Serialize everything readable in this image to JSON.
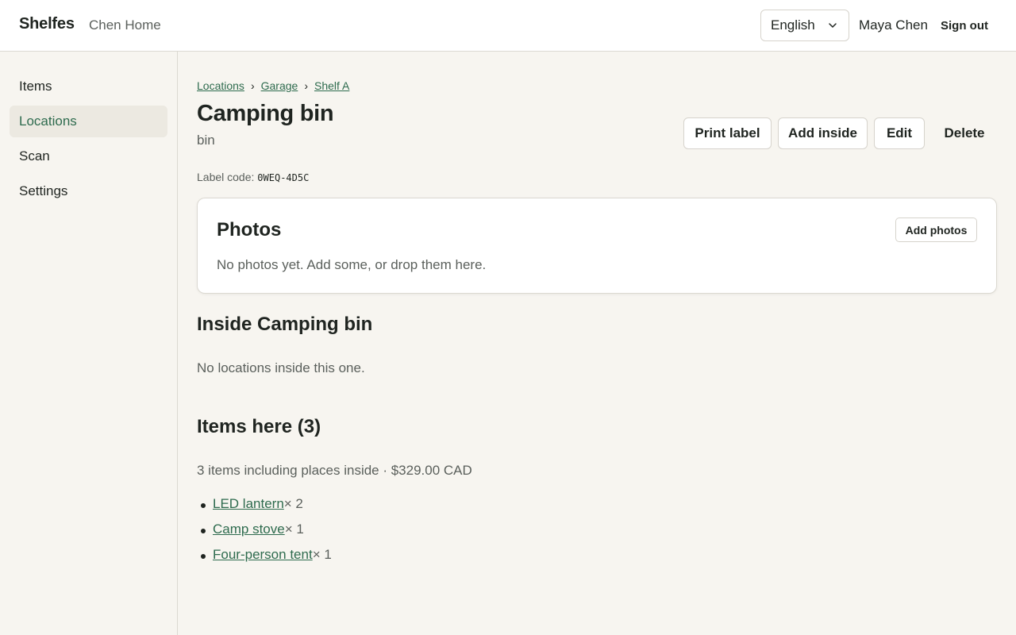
{
  "header": {
    "brand": "Shelfes",
    "household": "Chen Home",
    "language": "English",
    "user_name": "Maya Chen",
    "sign_out": "Sign out"
  },
  "sidebar": {
    "items": [
      {
        "label": "Items",
        "active": false
      },
      {
        "label": "Locations",
        "active": true
      },
      {
        "label": "Scan",
        "active": false
      },
      {
        "label": "Settings",
        "active": false
      }
    ]
  },
  "breadcrumb": {
    "items": [
      "Locations",
      "Garage",
      "Shelf A"
    ],
    "separator": "›"
  },
  "location": {
    "title": "Camping bin",
    "kind": "bin",
    "label_code_prefix": "Label code:",
    "label_code": "0WEQ-4D5C"
  },
  "actions": {
    "print_label": "Print label",
    "add_inside": "Add inside",
    "edit": "Edit",
    "delete": "Delete"
  },
  "photos": {
    "title": "Photos",
    "add_button": "Add photos",
    "empty_text": "No photos yet. Add some, or drop them here."
  },
  "inside": {
    "title": "Inside Camping bin",
    "empty_text": "No locations inside this one."
  },
  "items_here": {
    "title": "Items here (3)",
    "summary": "3 items including places inside · $329.00 CAD",
    "items": [
      {
        "name": "LED lantern",
        "quantity": "× 2"
      },
      {
        "name": "Camp stove",
        "quantity": "× 1"
      },
      {
        "name": "Four-person tent",
        "quantity": "× 1"
      }
    ]
  },
  "colors": {
    "accent": "#2e6b4e",
    "background": "#f7f5f0",
    "text": "#1f2420",
    "muted": "#5b605c",
    "active_nav_bg": "#ece9e1"
  }
}
